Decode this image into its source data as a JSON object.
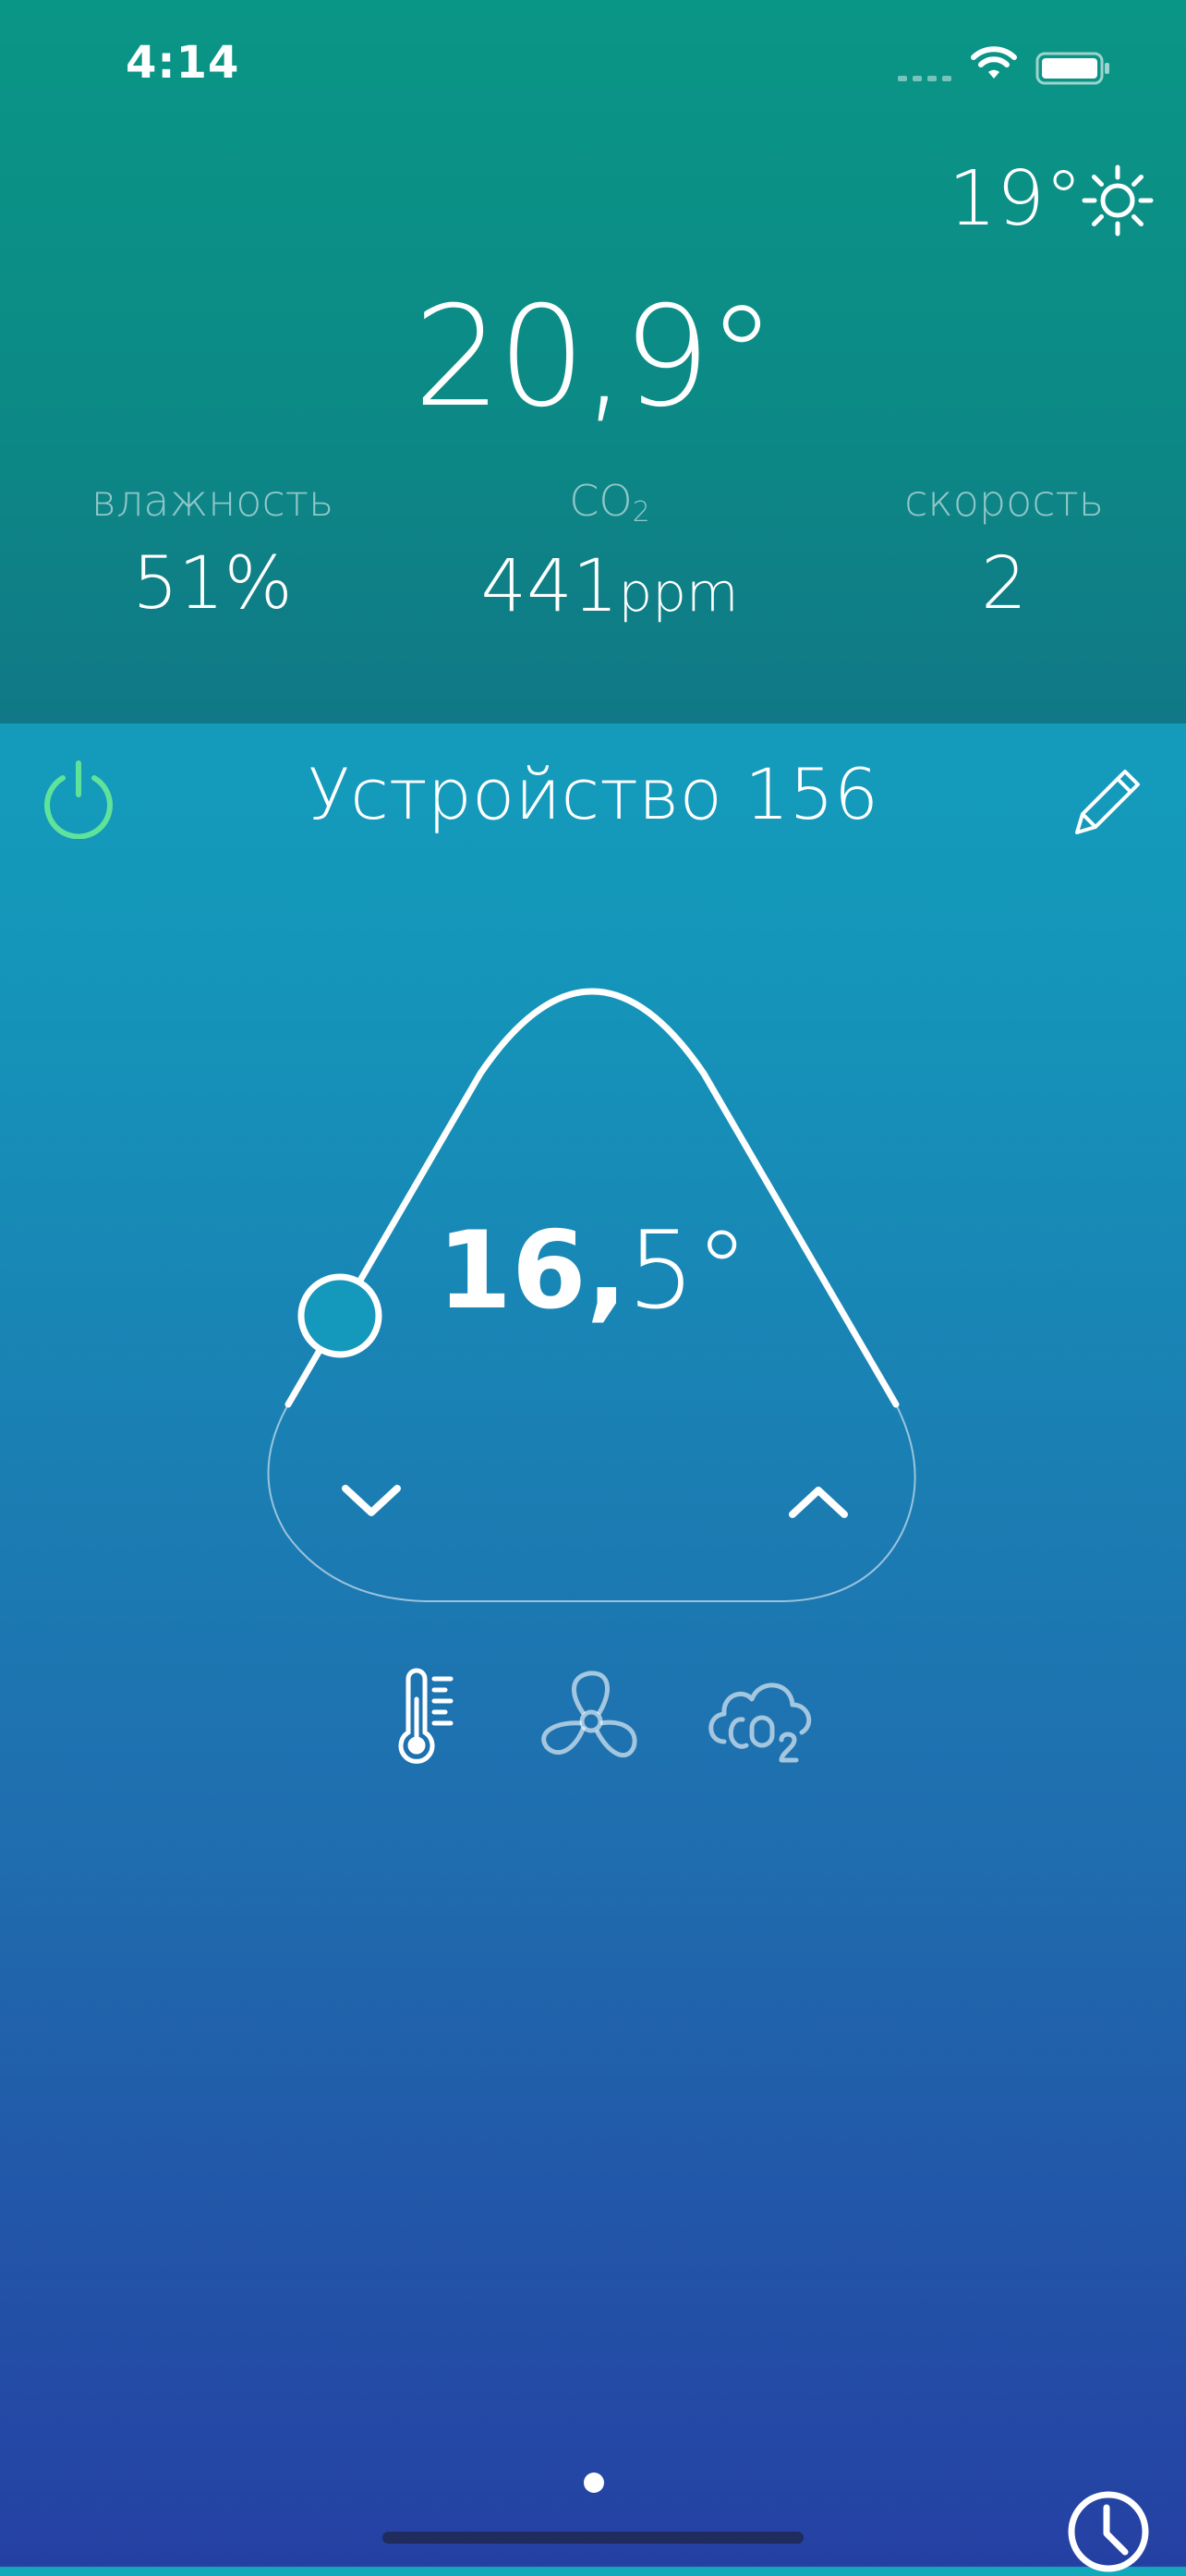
{
  "status_bar": {
    "time": "4:14"
  },
  "outdoor": {
    "temperature": "19°",
    "weather_icon": "sun-icon"
  },
  "indoor": {
    "temperature": "20,9°"
  },
  "metrics": {
    "humidity": {
      "label": "влажность",
      "value": "51%"
    },
    "co2": {
      "label_main": "CO",
      "label_sub": "2",
      "value": "441",
      "unit": "ppm"
    },
    "speed": {
      "label": "скорость",
      "value": "2"
    }
  },
  "device": {
    "name": "Устройство 156",
    "power_color": "#5fe39a"
  },
  "setpoint": {
    "integer": "16,",
    "fraction": "5°"
  },
  "modes": [
    "thermometer-icon",
    "fan-icon",
    "co2-cloud-icon"
  ],
  "colors": {
    "header_top": "#0a9686",
    "body_bottom": "#2540a3",
    "power_on": "#5fe39a"
  }
}
